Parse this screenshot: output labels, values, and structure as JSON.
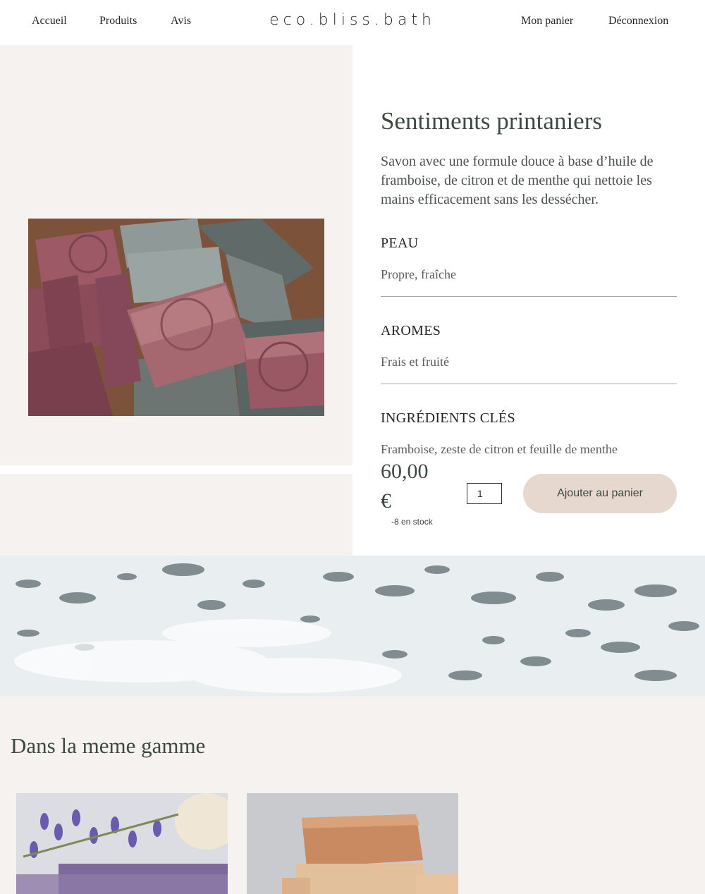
{
  "nav": {
    "left": [
      "Accueil",
      "Produits",
      "Avis"
    ],
    "brand": "eco.bliss.bath",
    "right": [
      "Mon panier",
      "Déconnexion"
    ]
  },
  "product": {
    "title": "Sentiments printaniers",
    "description": "Savon avec une formule douce à base d’huile de framboise, de citron et de menthe qui nettoie les mains efficacement sans les dessécher.",
    "sections": [
      {
        "heading": "PEAU",
        "value": "Propre, fraîche"
      },
      {
        "heading": "AROMES",
        "value": "Frais et fruité"
      },
      {
        "heading": "INGRÉDIENTS CLÉS",
        "value": "Framboise, zeste de citron et feuille de menthe"
      }
    ],
    "price": "60,00 €",
    "stock": "-8 en stock",
    "quantity": "1",
    "add_label": "Ajouter au panier"
  },
  "range": {
    "title": "Dans la meme gamme"
  },
  "colors": {
    "beige_bg": "#f6f2ef",
    "button": "#e7d8cf",
    "text": "#3d4a43"
  }
}
